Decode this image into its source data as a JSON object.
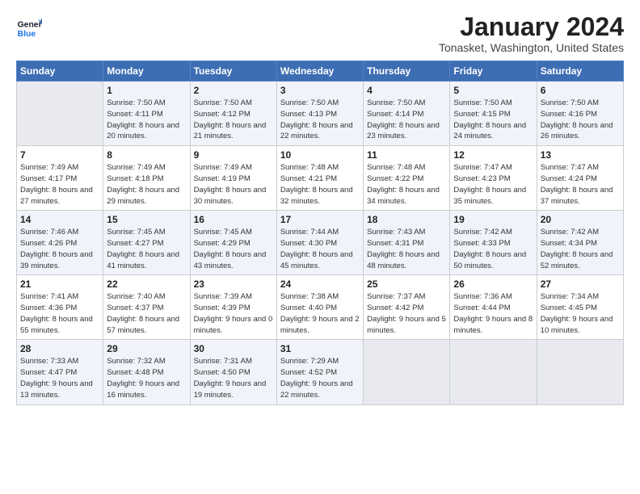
{
  "header": {
    "logo_general": "General",
    "logo_blue": "Blue",
    "month_title": "January 2024",
    "location": "Tonasket, Washington, United States"
  },
  "days_of_week": [
    "Sunday",
    "Monday",
    "Tuesday",
    "Wednesday",
    "Thursday",
    "Friday",
    "Saturday"
  ],
  "weeks": [
    [
      {
        "day": "",
        "sunrise": "",
        "sunset": "",
        "daylight": ""
      },
      {
        "day": "1",
        "sunrise": "Sunrise: 7:50 AM",
        "sunset": "Sunset: 4:11 PM",
        "daylight": "Daylight: 8 hours and 20 minutes."
      },
      {
        "day": "2",
        "sunrise": "Sunrise: 7:50 AM",
        "sunset": "Sunset: 4:12 PM",
        "daylight": "Daylight: 8 hours and 21 minutes."
      },
      {
        "day": "3",
        "sunrise": "Sunrise: 7:50 AM",
        "sunset": "Sunset: 4:13 PM",
        "daylight": "Daylight: 8 hours and 22 minutes."
      },
      {
        "day": "4",
        "sunrise": "Sunrise: 7:50 AM",
        "sunset": "Sunset: 4:14 PM",
        "daylight": "Daylight: 8 hours and 23 minutes."
      },
      {
        "day": "5",
        "sunrise": "Sunrise: 7:50 AM",
        "sunset": "Sunset: 4:15 PM",
        "daylight": "Daylight: 8 hours and 24 minutes."
      },
      {
        "day": "6",
        "sunrise": "Sunrise: 7:50 AM",
        "sunset": "Sunset: 4:16 PM",
        "daylight": "Daylight: 8 hours and 26 minutes."
      }
    ],
    [
      {
        "day": "7",
        "sunrise": "Sunrise: 7:49 AM",
        "sunset": "Sunset: 4:17 PM",
        "daylight": "Daylight: 8 hours and 27 minutes."
      },
      {
        "day": "8",
        "sunrise": "Sunrise: 7:49 AM",
        "sunset": "Sunset: 4:18 PM",
        "daylight": "Daylight: 8 hours and 29 minutes."
      },
      {
        "day": "9",
        "sunrise": "Sunrise: 7:49 AM",
        "sunset": "Sunset: 4:19 PM",
        "daylight": "Daylight: 8 hours and 30 minutes."
      },
      {
        "day": "10",
        "sunrise": "Sunrise: 7:48 AM",
        "sunset": "Sunset: 4:21 PM",
        "daylight": "Daylight: 8 hours and 32 minutes."
      },
      {
        "day": "11",
        "sunrise": "Sunrise: 7:48 AM",
        "sunset": "Sunset: 4:22 PM",
        "daylight": "Daylight: 8 hours and 34 minutes."
      },
      {
        "day": "12",
        "sunrise": "Sunrise: 7:47 AM",
        "sunset": "Sunset: 4:23 PM",
        "daylight": "Daylight: 8 hours and 35 minutes."
      },
      {
        "day": "13",
        "sunrise": "Sunrise: 7:47 AM",
        "sunset": "Sunset: 4:24 PM",
        "daylight": "Daylight: 8 hours and 37 minutes."
      }
    ],
    [
      {
        "day": "14",
        "sunrise": "Sunrise: 7:46 AM",
        "sunset": "Sunset: 4:26 PM",
        "daylight": "Daylight: 8 hours and 39 minutes."
      },
      {
        "day": "15",
        "sunrise": "Sunrise: 7:45 AM",
        "sunset": "Sunset: 4:27 PM",
        "daylight": "Daylight: 8 hours and 41 minutes."
      },
      {
        "day": "16",
        "sunrise": "Sunrise: 7:45 AM",
        "sunset": "Sunset: 4:29 PM",
        "daylight": "Daylight: 8 hours and 43 minutes."
      },
      {
        "day": "17",
        "sunrise": "Sunrise: 7:44 AM",
        "sunset": "Sunset: 4:30 PM",
        "daylight": "Daylight: 8 hours and 45 minutes."
      },
      {
        "day": "18",
        "sunrise": "Sunrise: 7:43 AM",
        "sunset": "Sunset: 4:31 PM",
        "daylight": "Daylight: 8 hours and 48 minutes."
      },
      {
        "day": "19",
        "sunrise": "Sunrise: 7:42 AM",
        "sunset": "Sunset: 4:33 PM",
        "daylight": "Daylight: 8 hours and 50 minutes."
      },
      {
        "day": "20",
        "sunrise": "Sunrise: 7:42 AM",
        "sunset": "Sunset: 4:34 PM",
        "daylight": "Daylight: 8 hours and 52 minutes."
      }
    ],
    [
      {
        "day": "21",
        "sunrise": "Sunrise: 7:41 AM",
        "sunset": "Sunset: 4:36 PM",
        "daylight": "Daylight: 8 hours and 55 minutes."
      },
      {
        "day": "22",
        "sunrise": "Sunrise: 7:40 AM",
        "sunset": "Sunset: 4:37 PM",
        "daylight": "Daylight: 8 hours and 57 minutes."
      },
      {
        "day": "23",
        "sunrise": "Sunrise: 7:39 AM",
        "sunset": "Sunset: 4:39 PM",
        "daylight": "Daylight: 9 hours and 0 minutes."
      },
      {
        "day": "24",
        "sunrise": "Sunrise: 7:38 AM",
        "sunset": "Sunset: 4:40 PM",
        "daylight": "Daylight: 9 hours and 2 minutes."
      },
      {
        "day": "25",
        "sunrise": "Sunrise: 7:37 AM",
        "sunset": "Sunset: 4:42 PM",
        "daylight": "Daylight: 9 hours and 5 minutes."
      },
      {
        "day": "26",
        "sunrise": "Sunrise: 7:36 AM",
        "sunset": "Sunset: 4:44 PM",
        "daylight": "Daylight: 9 hours and 8 minutes."
      },
      {
        "day": "27",
        "sunrise": "Sunrise: 7:34 AM",
        "sunset": "Sunset: 4:45 PM",
        "daylight": "Daylight: 9 hours and 10 minutes."
      }
    ],
    [
      {
        "day": "28",
        "sunrise": "Sunrise: 7:33 AM",
        "sunset": "Sunset: 4:47 PM",
        "daylight": "Daylight: 9 hours and 13 minutes."
      },
      {
        "day": "29",
        "sunrise": "Sunrise: 7:32 AM",
        "sunset": "Sunset: 4:48 PM",
        "daylight": "Daylight: 9 hours and 16 minutes."
      },
      {
        "day": "30",
        "sunrise": "Sunrise: 7:31 AM",
        "sunset": "Sunset: 4:50 PM",
        "daylight": "Daylight: 9 hours and 19 minutes."
      },
      {
        "day": "31",
        "sunrise": "Sunrise: 7:29 AM",
        "sunset": "Sunset: 4:52 PM",
        "daylight": "Daylight: 9 hours and 22 minutes."
      },
      {
        "day": "",
        "sunrise": "",
        "sunset": "",
        "daylight": ""
      },
      {
        "day": "",
        "sunrise": "",
        "sunset": "",
        "daylight": ""
      },
      {
        "day": "",
        "sunrise": "",
        "sunset": "",
        "daylight": ""
      }
    ]
  ]
}
